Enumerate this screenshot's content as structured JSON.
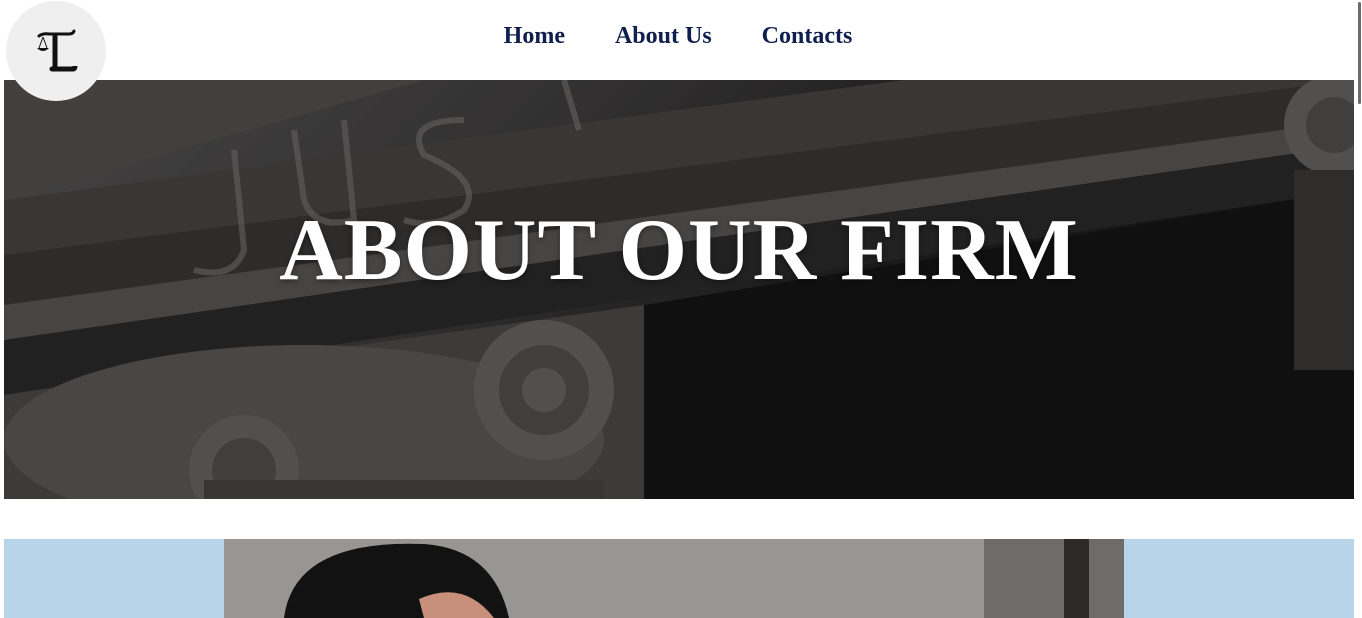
{
  "nav": {
    "items": [
      {
        "label": "Home"
      },
      {
        "label": "About Us"
      },
      {
        "label": "Contacts"
      }
    ]
  },
  "logo": {
    "icon": "scales-of-justice-monogram-icon"
  },
  "hero": {
    "title": "ABOUT OUR FIRM",
    "background": "courthouse-facade-justice-image"
  },
  "feature": {
    "background": "portrait-photo-image"
  },
  "colors": {
    "nav_text": "#0f1f4d",
    "feature_band": "#b7d4e8",
    "logo_bg": "#efefef"
  }
}
